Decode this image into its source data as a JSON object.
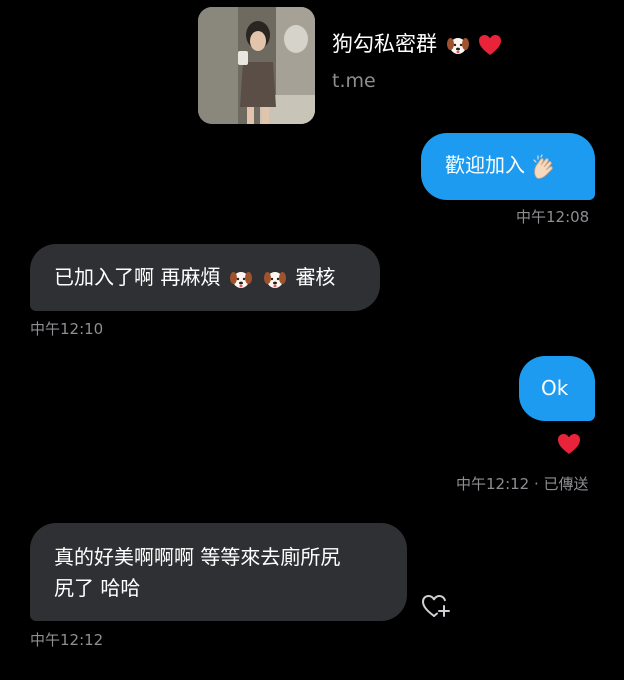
{
  "link_preview": {
    "title": "狗勾私密群",
    "domain": "t.me",
    "title_emojis": [
      "dog-face-emoji",
      "red-heart-emoji"
    ]
  },
  "messages": [
    {
      "direction": "outgoing",
      "text": "歡迎加入",
      "emoji": "clapping-hands-emoji",
      "time": "中午12:08"
    },
    {
      "direction": "incoming",
      "text_before": "已加入了啊 再麻煩",
      "emoji": "dog-face-emoji",
      "text_after": "審核",
      "time": "中午12:10"
    },
    {
      "direction": "outgoing",
      "text": "Ok",
      "reaction": "red-heart-emoji",
      "time": "中午12:12",
      "status": " · 已傳送"
    },
    {
      "direction": "incoming",
      "line1": "真的好美啊啊啊 等等來去廁所尻",
      "line2": "尻了 哈哈",
      "time": "中午12:12"
    }
  ],
  "colors": {
    "outgoing_bubble": "#1d9bf0",
    "incoming_bubble": "#2f3033",
    "timestamp": "#8e8e93",
    "background": "#000000"
  }
}
